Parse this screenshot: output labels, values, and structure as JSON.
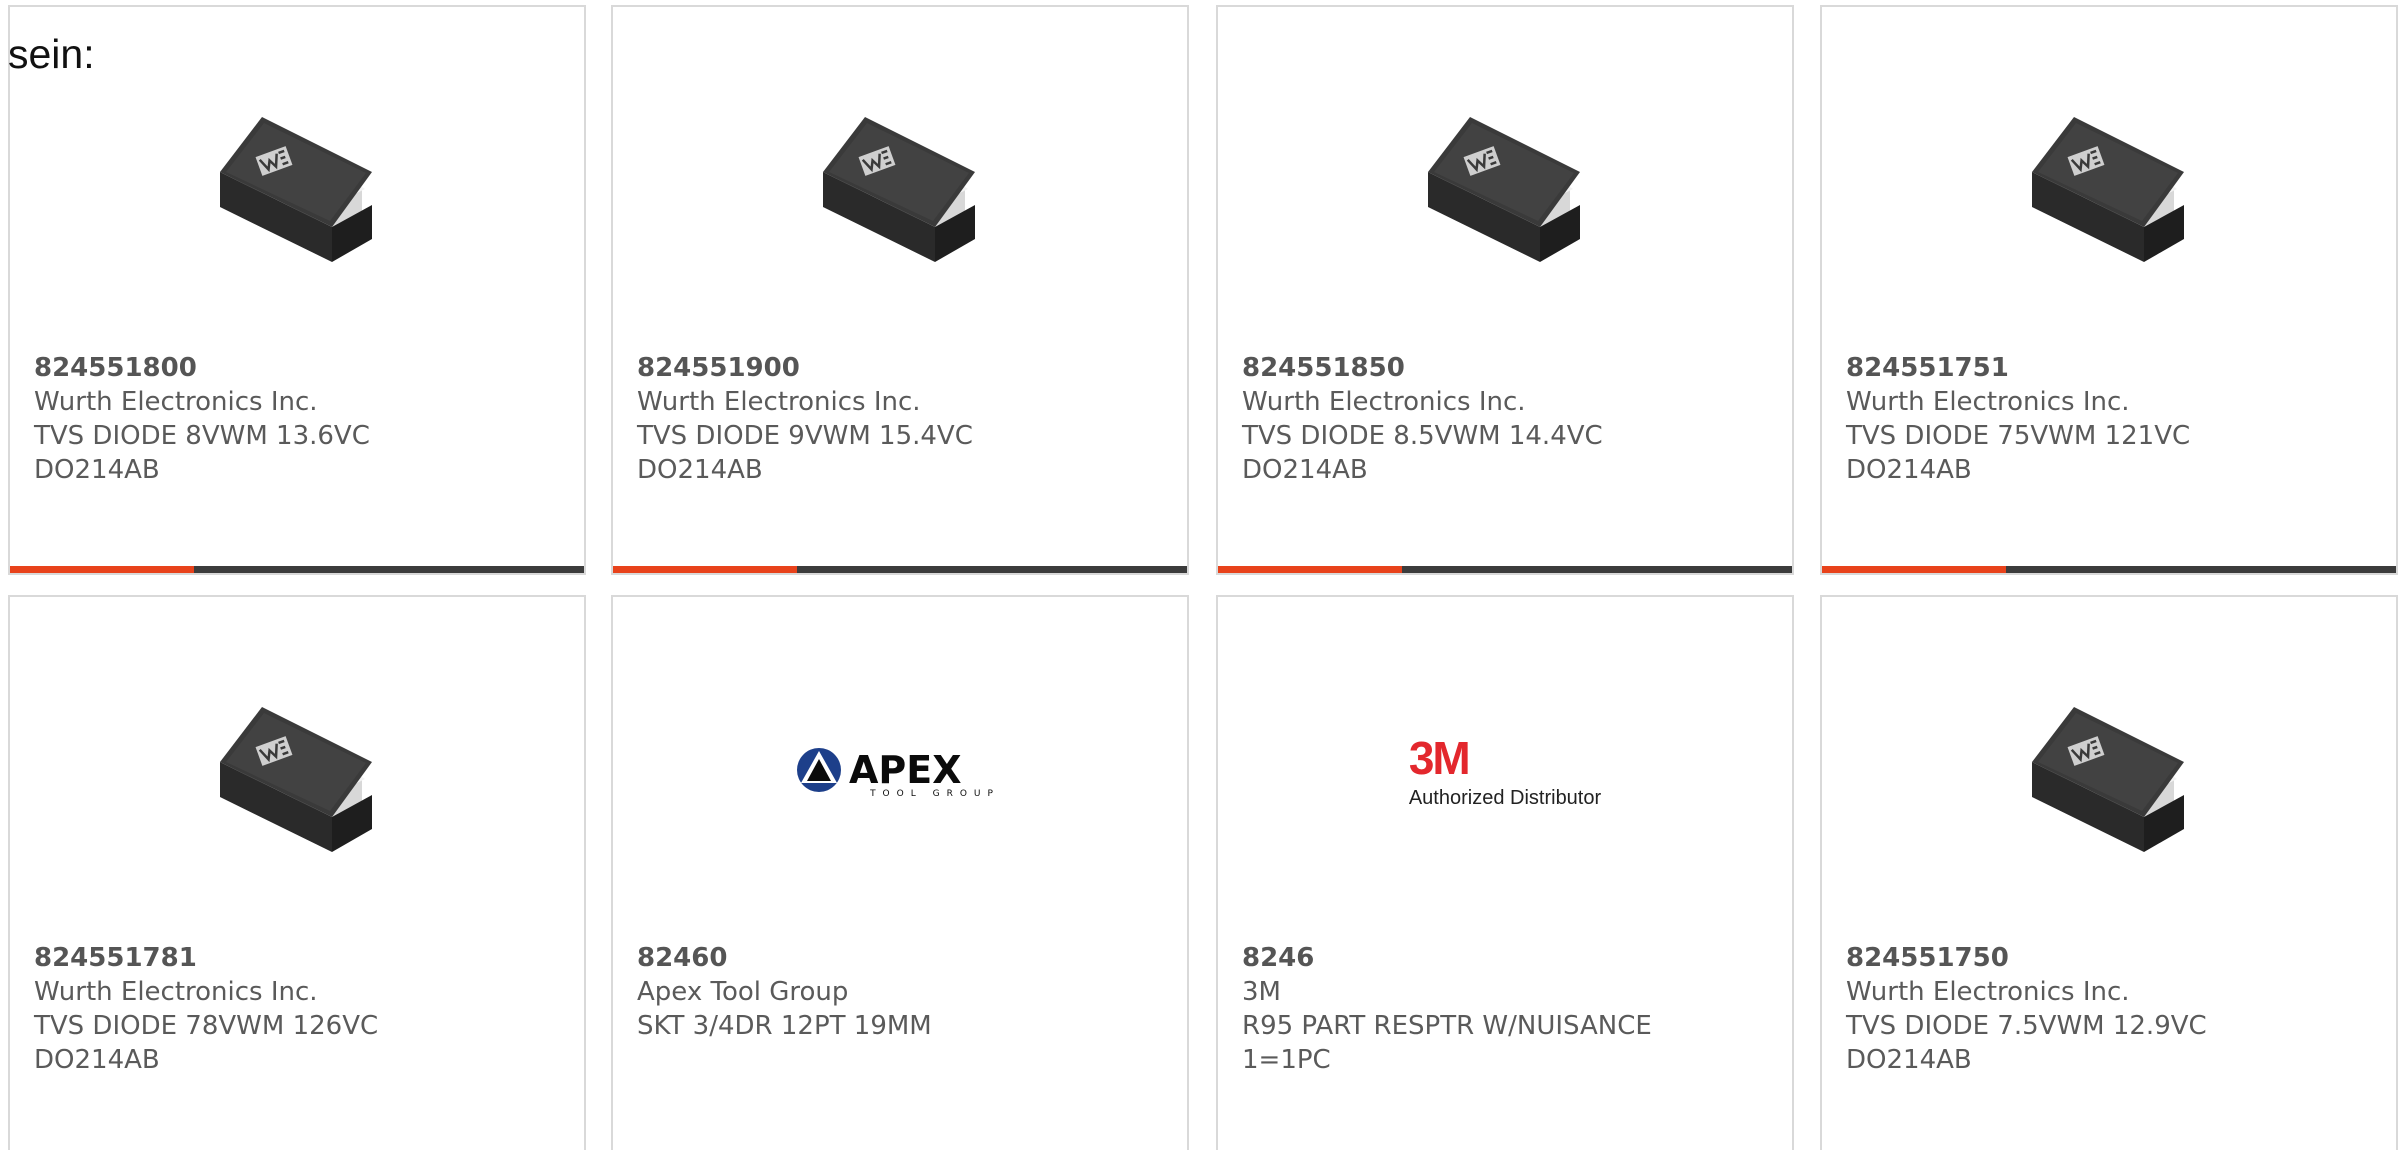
{
  "lead_text": "sein:",
  "products": [
    {
      "part_number": "824551800",
      "manufacturer": "Wurth Electronics Inc.",
      "description_line1": "TVS DIODE 8VWM 13.6VC",
      "description_line2": "DO214AB",
      "image": "diode-package",
      "accent_bar": true
    },
    {
      "part_number": "824551900",
      "manufacturer": "Wurth Electronics Inc.",
      "description_line1": "TVS DIODE 9VWM 15.4VC",
      "description_line2": "DO214AB",
      "image": "diode-package",
      "accent_bar": true
    },
    {
      "part_number": "824551850",
      "manufacturer": "Wurth Electronics Inc.",
      "description_line1": "TVS DIODE 8.5VWM 14.4VC",
      "description_line2": "DO214AB",
      "image": "diode-package",
      "accent_bar": true
    },
    {
      "part_number": "824551751",
      "manufacturer": "Wurth Electronics Inc.",
      "description_line1": "TVS DIODE 75VWM 121VC",
      "description_line2": "DO214AB",
      "image": "diode-package",
      "accent_bar": true
    },
    {
      "part_number": "824551781",
      "manufacturer": "Wurth Electronics Inc.",
      "description_line1": "TVS DIODE 78VWM 126VC",
      "description_line2": "DO214AB",
      "image": "diode-package",
      "accent_bar": false
    },
    {
      "part_number": "82460",
      "manufacturer": "Apex Tool Group",
      "description_line1": "SKT 3/4DR 12PT 19MM",
      "description_line2": "",
      "image": "apex-logo",
      "accent_bar": false
    },
    {
      "part_number": "8246",
      "manufacturer": "3M",
      "description_line1": "R95 PART RESPTR W/NUISANCE",
      "description_line2": "1=1PC",
      "image": "3m-logo",
      "accent_bar": false
    },
    {
      "part_number": "824551750",
      "manufacturer": "Wurth Electronics Inc.",
      "description_line1": "TVS DIODE 7.5VWM 12.9VC",
      "description_line2": "DO214AB",
      "image": "diode-package",
      "accent_bar": false
    }
  ],
  "logos": {
    "apex_word": "APEX",
    "apex_sub": "TOOL GROUP",
    "threem_word": "3M",
    "threem_sub": "Authorized Distributor"
  },
  "colors": {
    "accent": "#e8421b",
    "bar_dark": "#3c3c3c",
    "border": "#d9d9d9",
    "text": "#5a5a5a",
    "threem_red": "#e3272d"
  }
}
